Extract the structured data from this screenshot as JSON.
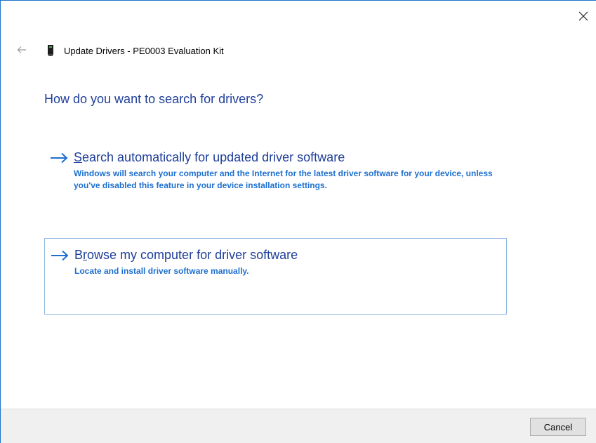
{
  "window": {
    "title": "Update Drivers - PE0003 Evaluation Kit",
    "close_icon": "close-icon",
    "back_icon": "back-arrow-icon",
    "device_icon": "usb-device-icon"
  },
  "main": {
    "heading": "How do you want to search for drivers?",
    "options": [
      {
        "accel": "S",
        "title_rest": "earch automatically for updated driver software",
        "description": "Windows will search your computer and the Internet for the latest driver software for your device, unless you've disabled this feature in your device installation settings.",
        "icon": "arrow-right-icon"
      },
      {
        "accel": "r",
        "title_prefix": "B",
        "title_rest": "owse my computer for driver software",
        "description": "Locate and install driver software manually.",
        "icon": "arrow-right-icon"
      }
    ]
  },
  "footer": {
    "cancel_label": "Cancel"
  },
  "colors": {
    "heading_blue": "#1f3f99",
    "link_blue": "#1d6fcf",
    "footer_bg": "#f0f0f0",
    "selection_border": "#8fb6e0"
  }
}
